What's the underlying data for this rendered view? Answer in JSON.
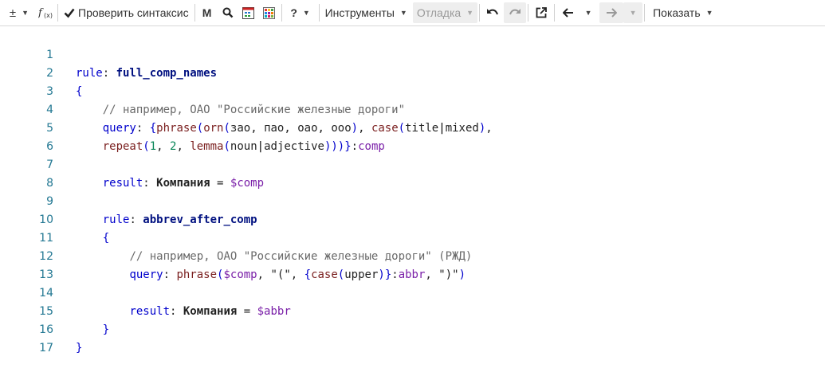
{
  "toolbar": {
    "insert_symbol": "±",
    "check_syntax_label": "Проверить синтаксис",
    "bold_m": "M",
    "help_label": "?",
    "tools_label": "Инструменты",
    "debug_label": "Отладка",
    "show_label": "Показать"
  },
  "editor": {
    "line_numbers": [
      "1",
      "2",
      "3",
      "4",
      "5",
      "6",
      "7",
      "8",
      "9",
      "10",
      "11",
      "12",
      "13",
      "14",
      "15",
      "16",
      "17"
    ],
    "tokens": {
      "l1_kw": "rule",
      "l1_name": "full_comp_names",
      "l2": "{",
      "l3": "// например, ОАО \"Российские железные дороги\"",
      "l4_kw": "query",
      "l4_open": "{",
      "l4_phrase": "phrase",
      "l4_orn": "orn",
      "l4_args": "зао, пао, оао, ооо",
      "l4_case": "case",
      "l4_title": "title",
      "l4_mixed": "mixed",
      "l5_repeat": "repeat",
      "l5_n1": "1",
      "l5_n2": "2",
      "l5_lemma": "lemma",
      "l5_noun": "noun",
      "l5_adj": "adjective",
      "l5_var": "comp",
      "l7_kw": "result",
      "l7_field": "Компания",
      "l7_var": "$comp",
      "l9_kw": "rule",
      "l9_name": "abbrev_after_comp",
      "l10": "{",
      "l11": "// например, ОАО \"Российские железные дороги\" (РЖД)",
      "l12_kw": "query",
      "l12_phrase": "phrase",
      "l12_var": "$comp",
      "l12_str1": "\"(\"",
      "l12_case": "case",
      "l12_upper": "upper",
      "l12_abbr": "abbr",
      "l12_str2": "\")\"",
      "l14_kw": "result",
      "l14_field": "Компания",
      "l14_var": "$abbr",
      "l15": "}",
      "l16": "}"
    }
  },
  "colors": {
    "line_number": "#237893",
    "keyword": "#0000cc",
    "function": "#7a1f1f",
    "variable": "#7a1fa8",
    "comment": "#6a6a6a",
    "number": "#098658"
  }
}
